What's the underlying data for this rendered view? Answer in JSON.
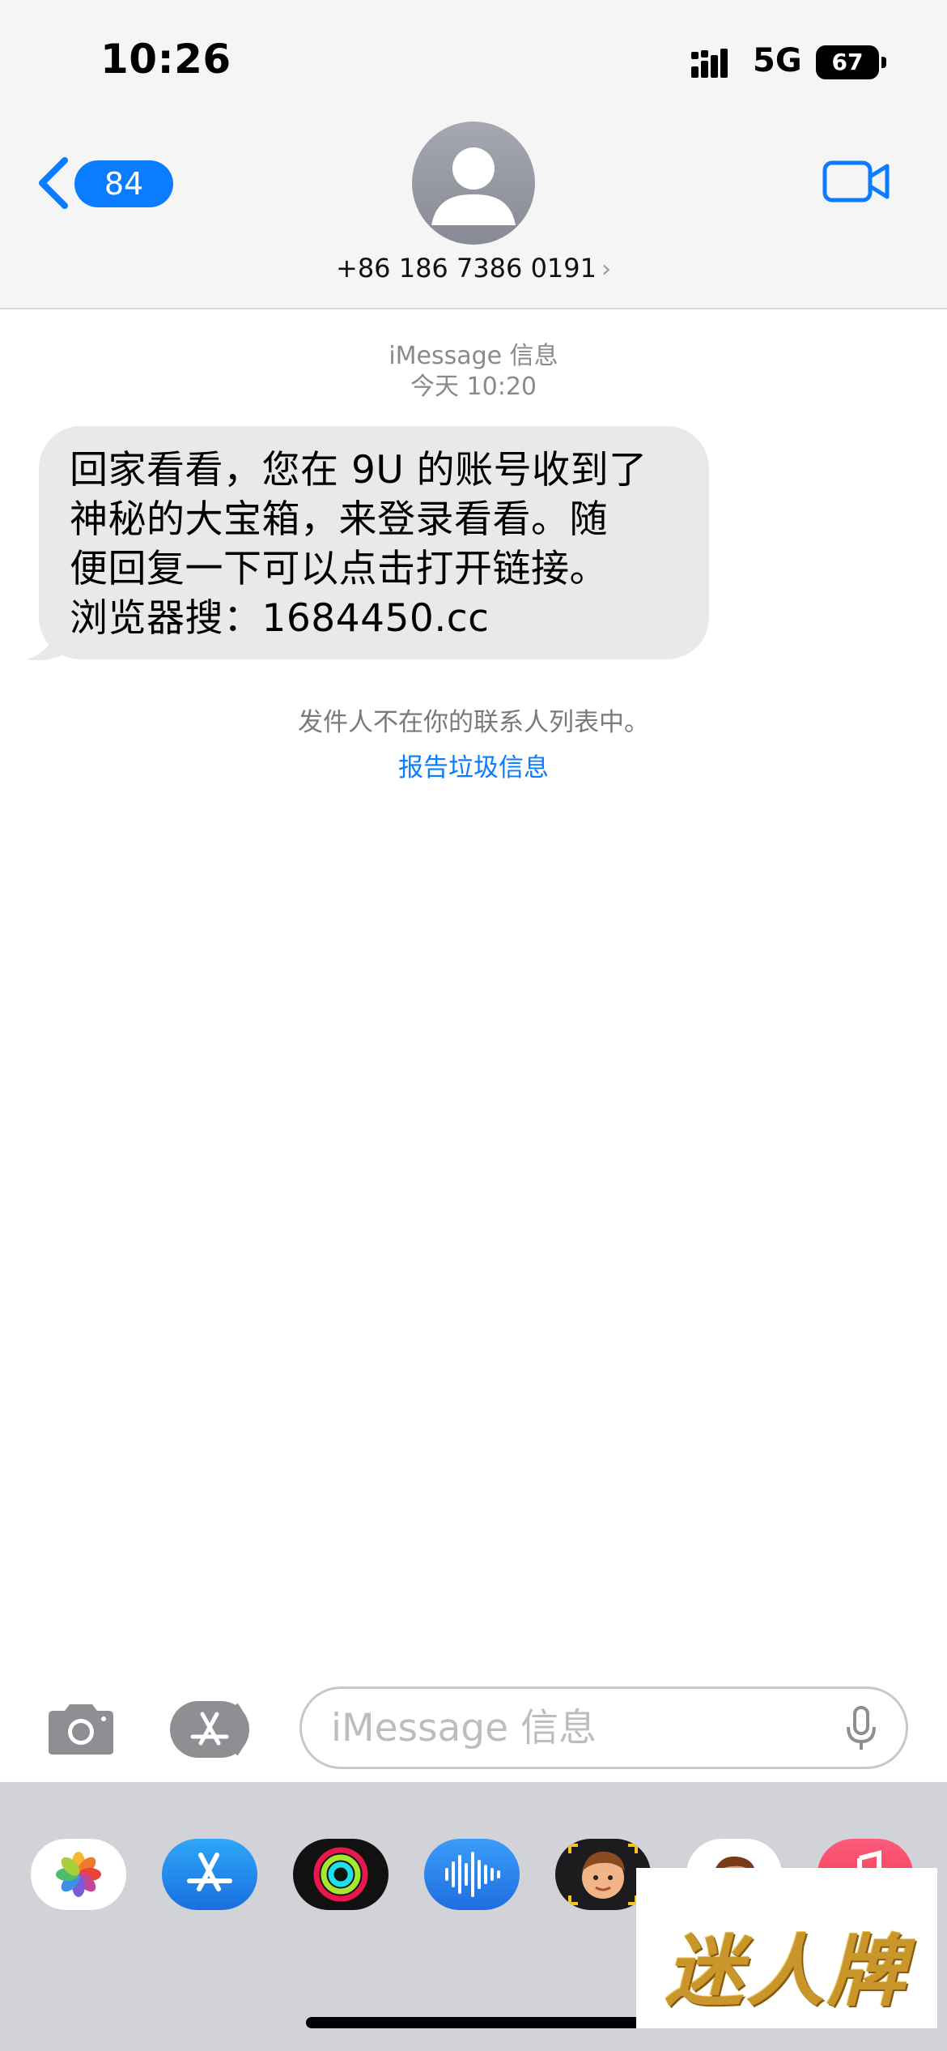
{
  "status_bar": {
    "time": "10:26",
    "network": "5G",
    "battery": "67"
  },
  "header": {
    "back_badge": "84",
    "contact_name": "+86 186 7386 0191",
    "contact_chevron": "›",
    "accent_color": "#0a7cff"
  },
  "conversation": {
    "service": "iMessage 信息",
    "timestamp": "今天 10:20",
    "message_lines": [
      "回家看看，您在 9U 的账号收到了",
      "神秘的大宝箱，来登录看看。随",
      "便回复一下可以点击打开链接。",
      "浏览器搜：1684450.cc"
    ],
    "sender_notice": "发件人不在你的联系人列表中。",
    "report_link": "报告垃圾信息"
  },
  "composer": {
    "placeholder": "iMessage 信息"
  },
  "app_drawer": {
    "apps": [
      "photos-icon",
      "app-store-icon",
      "activity-icon",
      "audio-message-icon",
      "memoji-icon",
      "memoji-stickers-icon",
      "music-icon"
    ]
  },
  "watermark": {
    "text": "迷人牌"
  }
}
